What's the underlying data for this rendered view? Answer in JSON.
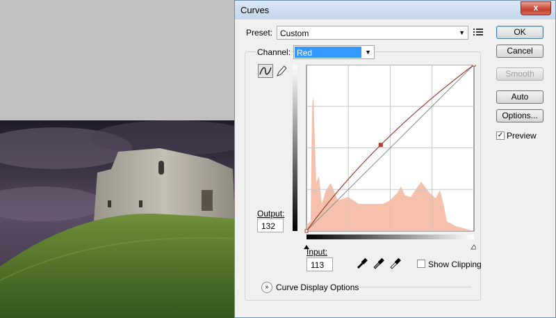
{
  "dialog": {
    "title": "Curves",
    "close_glyph": "x"
  },
  "preset": {
    "label": "Preset:",
    "value": "Custom"
  },
  "channel": {
    "label": "Channel:",
    "value": "Red"
  },
  "buttons": {
    "ok": "OK",
    "cancel": "Cancel",
    "smooth": "Smooth",
    "auto": "Auto",
    "options": "Options..."
  },
  "preview": {
    "label": "Preview",
    "checked": true
  },
  "output": {
    "label": "Output:",
    "value": "132"
  },
  "input": {
    "label": "Input:",
    "value": "113"
  },
  "show_clipping": {
    "label": "Show Clipping",
    "checked": false
  },
  "curve_display_options": {
    "label": "Curve Display Options"
  },
  "curve": {
    "points": [
      [
        0,
        0
      ],
      [
        113,
        132
      ],
      [
        255,
        255
      ]
    ],
    "selected_point": [
      113,
      132
    ]
  },
  "colors": {
    "curve": "#9b3b2c",
    "histogram": "#f5c1ad",
    "accent_select": "#3399ff"
  }
}
